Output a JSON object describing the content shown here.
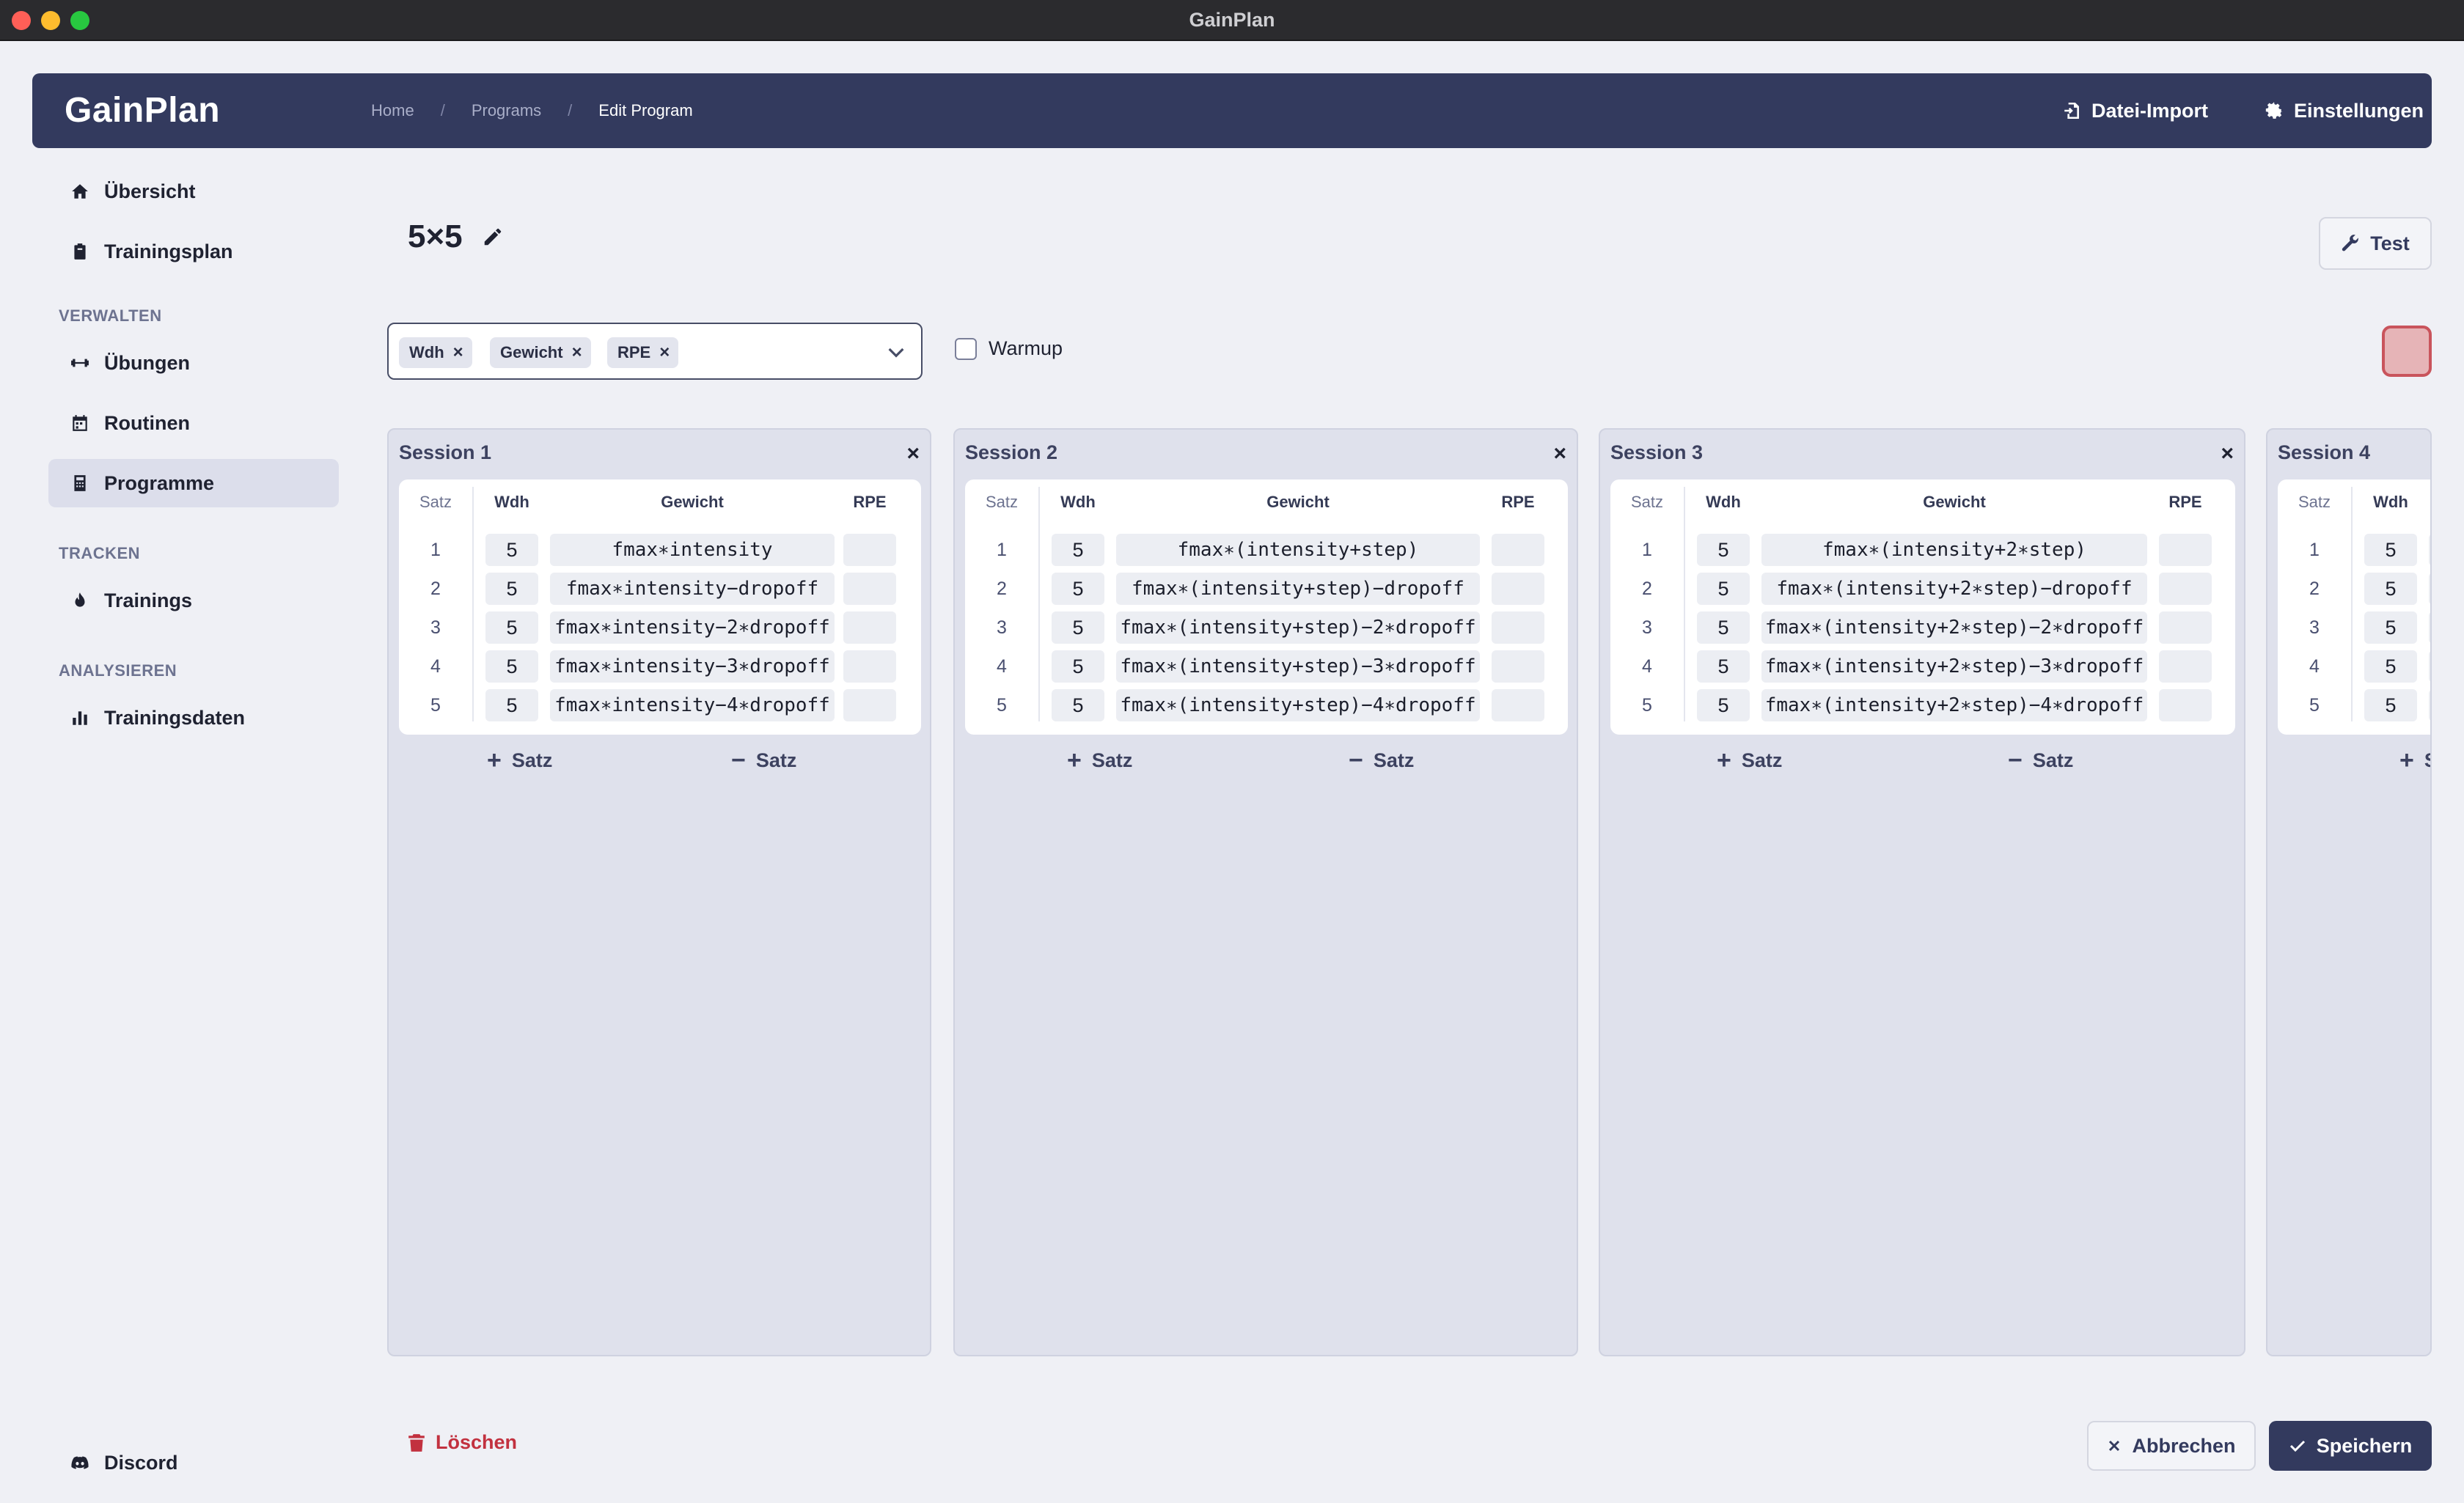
{
  "window": {
    "title": "GainPlan"
  },
  "header": {
    "logo": "GainPlan",
    "breadcrumb": [
      "Home",
      "Programs",
      "Edit Program"
    ],
    "import_label": "Datei-Import",
    "settings_label": "Einstellungen"
  },
  "sidebar": {
    "top": [
      {
        "label": "Übersicht",
        "icon": "home-icon"
      },
      {
        "label": "Trainingsplan",
        "icon": "clipboard-icon"
      }
    ],
    "sections": [
      {
        "label": "VERWALTEN"
      },
      {
        "label": "TRACKEN"
      },
      {
        "label": "ANALYSIEREN"
      }
    ],
    "verwalten": [
      {
        "label": "Übungen",
        "icon": "dumbbell-icon"
      },
      {
        "label": "Routinen",
        "icon": "calendar-icon"
      },
      {
        "label": "Programme",
        "icon": "calculator-icon",
        "active": true
      }
    ],
    "tracken": [
      {
        "label": "Trainings",
        "icon": "flame-icon"
      }
    ],
    "analysieren": [
      {
        "label": "Trainingsdaten",
        "icon": "bar-chart-icon"
      }
    ],
    "bottom": {
      "label": "Discord",
      "icon": "discord-icon"
    }
  },
  "program": {
    "title": "5×5",
    "test_label": "Test",
    "columns_chips": [
      "Wdh",
      "Gewicht",
      "RPE"
    ],
    "warmup_label": "Warmup",
    "warmup_checked": false,
    "color": "#e6b4b7"
  },
  "table_headers": {
    "satz": "Satz",
    "wdh": "Wdh",
    "gewicht": "Gewicht",
    "rpe": "RPE"
  },
  "set_buttons": {
    "add": "Satz",
    "remove": "Satz"
  },
  "sessions": [
    {
      "title": "Session 1",
      "sets": [
        {
          "n": "1",
          "wdh": "5",
          "gewicht": "fmax∗intensity",
          "rpe": ""
        },
        {
          "n": "2",
          "wdh": "5",
          "gewicht": "fmax∗intensity−dropoff",
          "rpe": ""
        },
        {
          "n": "3",
          "wdh": "5",
          "gewicht": "fmax∗intensity−2∗dropoff",
          "rpe": ""
        },
        {
          "n": "4",
          "wdh": "5",
          "gewicht": "fmax∗intensity−3∗dropoff",
          "rpe": ""
        },
        {
          "n": "5",
          "wdh": "5",
          "gewicht": "fmax∗intensity−4∗dropoff",
          "rpe": ""
        }
      ]
    },
    {
      "title": "Session 2",
      "sets": [
        {
          "n": "1",
          "wdh": "5",
          "gewicht": "fmax∗(intensity+step)",
          "rpe": ""
        },
        {
          "n": "2",
          "wdh": "5",
          "gewicht": "fmax∗(intensity+step)−dropoff",
          "rpe": ""
        },
        {
          "n": "3",
          "wdh": "5",
          "gewicht": "fmax∗(intensity+step)−2∗dropoff",
          "rpe": ""
        },
        {
          "n": "4",
          "wdh": "5",
          "gewicht": "fmax∗(intensity+step)−3∗dropoff",
          "rpe": ""
        },
        {
          "n": "5",
          "wdh": "5",
          "gewicht": "fmax∗(intensity+step)−4∗dropoff",
          "rpe": ""
        }
      ]
    },
    {
      "title": "Session 3",
      "sets": [
        {
          "n": "1",
          "wdh": "5",
          "gewicht": "fmax∗(intensity+2∗step)",
          "rpe": ""
        },
        {
          "n": "2",
          "wdh": "5",
          "gewicht": "fmax∗(intensity+2∗step)−dropoff",
          "rpe": ""
        },
        {
          "n": "3",
          "wdh": "5",
          "gewicht": "fmax∗(intensity+2∗step)−2∗dropoff",
          "rpe": ""
        },
        {
          "n": "4",
          "wdh": "5",
          "gewicht": "fmax∗(intensity+2∗step)−3∗dropoff",
          "rpe": ""
        },
        {
          "n": "5",
          "wdh": "5",
          "gewicht": "fmax∗(intensity+2∗step)−4∗dropoff",
          "rpe": ""
        }
      ]
    },
    {
      "title": "Session 4",
      "sets": [
        {
          "n": "1",
          "wdh": "5"
        },
        {
          "n": "2",
          "wdh": "5"
        },
        {
          "n": "3",
          "wdh": "5"
        },
        {
          "n": "4",
          "wdh": "5"
        },
        {
          "n": "5",
          "wdh": "5"
        }
      ]
    }
  ],
  "footer": {
    "delete_label": "Löschen",
    "cancel_label": "Abbrechen",
    "save_label": "Speichern"
  }
}
